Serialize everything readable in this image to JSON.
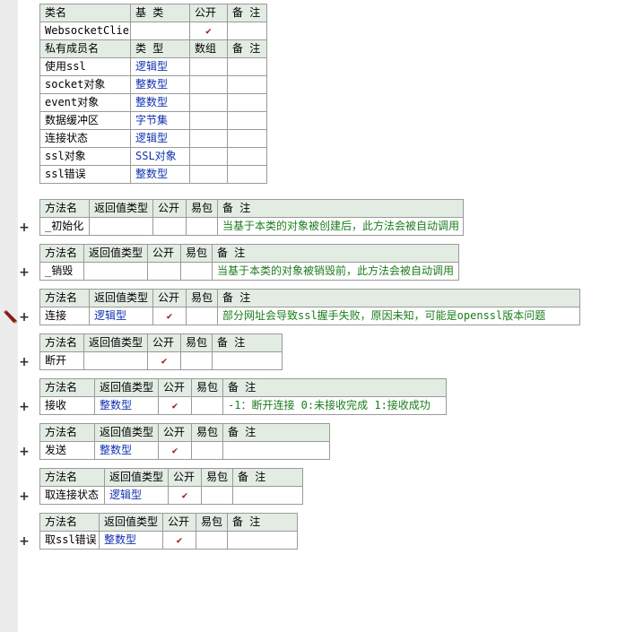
{
  "class_header": {
    "col_name": "类名",
    "col_base": "基 类",
    "col_public": "公开",
    "col_note": "备 注",
    "class_name": "WebsocketClient",
    "base": "",
    "public": true,
    "note": ""
  },
  "member_header": {
    "col_name": "私有成员名",
    "col_type": "类 型",
    "col_array": "数组",
    "col_note": "备 注"
  },
  "members": [
    {
      "name": "使用ssl",
      "type": "逻辑型"
    },
    {
      "name": "socket对象",
      "type": "整数型"
    },
    {
      "name": "event对象",
      "type": "整数型"
    },
    {
      "name": "数据缓冲区",
      "type": "字节集"
    },
    {
      "name": "连接状态",
      "type": "逻辑型"
    },
    {
      "name": "ssl对象",
      "type": "SSL对象"
    },
    {
      "name": "ssl错误",
      "type": "整数型"
    }
  ],
  "method_header": {
    "col_name": "方法名",
    "col_return": "返回值类型",
    "col_public": "公开",
    "col_easy": "易包",
    "col_note": "备 注"
  },
  "methods": [
    {
      "name": "_初始化",
      "ret": "",
      "public": false,
      "note": "当基于本类的对象被创建后，此方法会被自动调用"
    },
    {
      "name": "_销毁",
      "ret": "",
      "public": false,
      "note": "当基于本类的对象被销毁前，此方法会被自动调用"
    },
    {
      "name": "连接",
      "ret": "逻辑型",
      "public": true,
      "note": "部分网址会导致ssl握手失败，原因未知，可能是openssl版本问题"
    },
    {
      "name": "断开",
      "ret": "",
      "public": true,
      "note": ""
    },
    {
      "name": "接收",
      "ret": "整数型",
      "public": true,
      "note": "-1：断开连接 0:未接收完成  1:接收成功"
    },
    {
      "name": "发送",
      "ret": "整数型",
      "public": true,
      "note": ""
    },
    {
      "name": "取连接状态",
      "ret": "逻辑型",
      "public": true,
      "note": ""
    },
    {
      "name": "取ssl错误",
      "ret": "整数型",
      "public": true,
      "note": ""
    }
  ],
  "glyphs": {
    "check": "✔",
    "expand": "+"
  },
  "colors": {
    "header_bg": "#e3ece3",
    "type_link": "#1030b0",
    "note_text": "#1c7c1c",
    "check": "#a01818"
  }
}
